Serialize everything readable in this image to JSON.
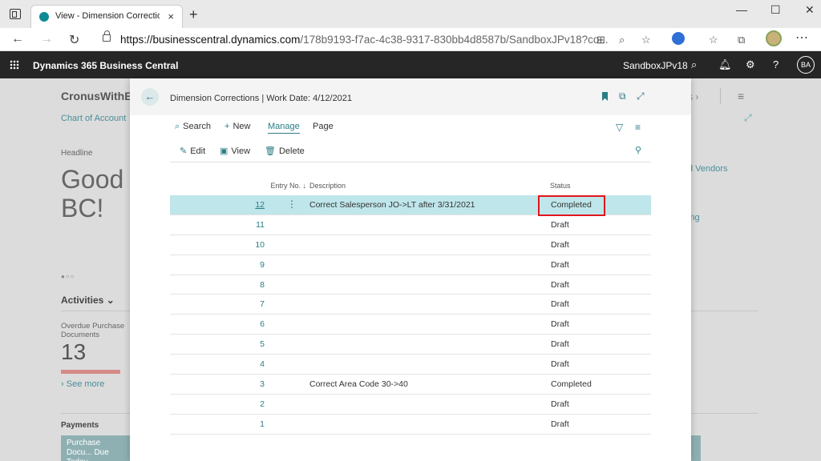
{
  "browser": {
    "tab_title": "View - Dimension Corrections - D",
    "tab_close": "×",
    "new_tab": "+",
    "url_host": "https://businesscentral.dynamics.com",
    "url_rest": "/178b9193-f7ac-4c38-9317-830bb4d8587b/SandboxJPv18?co...",
    "controls": {
      "minimize": "—",
      "maximize": "☐",
      "close": "✕"
    }
  },
  "app": {
    "name": "Dynamics 365 Business Central",
    "environment": "SandboxJPv18",
    "avatar": "BA"
  },
  "background": {
    "company": "CronusWithE",
    "chart_link": "Chart of Account",
    "headline": "Headline",
    "greeting_line1": "Good",
    "greeting_line2": "BC!",
    "activities": "Activities",
    "overdue_label": "Overdue Purchase Documents",
    "overdue_count": "13",
    "overdue_bar_fraction": 0.65,
    "see_more": "See more",
    "payments": "Payments",
    "tile_label": "Purchase Docu... Due Today",
    "vendors": "d Vendors",
    "ng": "ing",
    "rt": "s"
  },
  "dialog": {
    "title": "Dimension Corrections | Work Date: 4/12/2021",
    "actions": {
      "search": "Search",
      "new": "New",
      "manage": "Manage",
      "page": "Page",
      "edit": "Edit",
      "view": "View",
      "delete": "Delete"
    },
    "columns": {
      "entry_no": "Entry No. ↓",
      "description": "Description",
      "status": "Status"
    },
    "rows": [
      {
        "entry": "12",
        "description": "Correct Salesperson JO->LT after 3/31/2021",
        "status": "Completed",
        "selected": true
      },
      {
        "entry": "11",
        "description": "",
        "status": "Draft"
      },
      {
        "entry": "10",
        "description": "",
        "status": "Draft"
      },
      {
        "entry": "9",
        "description": "",
        "status": "Draft"
      },
      {
        "entry": "8",
        "description": "",
        "status": "Draft"
      },
      {
        "entry": "7",
        "description": "",
        "status": "Draft"
      },
      {
        "entry": "6",
        "description": "",
        "status": "Draft"
      },
      {
        "entry": "5",
        "description": "",
        "status": "Draft"
      },
      {
        "entry": "4",
        "description": "",
        "status": "Draft"
      },
      {
        "entry": "3",
        "description": "Correct Area Code 30->40",
        "status": "Completed"
      },
      {
        "entry": "2",
        "description": "",
        "status": "Draft"
      },
      {
        "entry": "1",
        "description": "",
        "status": "Draft"
      }
    ]
  },
  "colors": {
    "accent": "#2b7d85",
    "selected_row": "#bfe6ea",
    "highlight": "#e0161e",
    "appbar": "#262626"
  }
}
